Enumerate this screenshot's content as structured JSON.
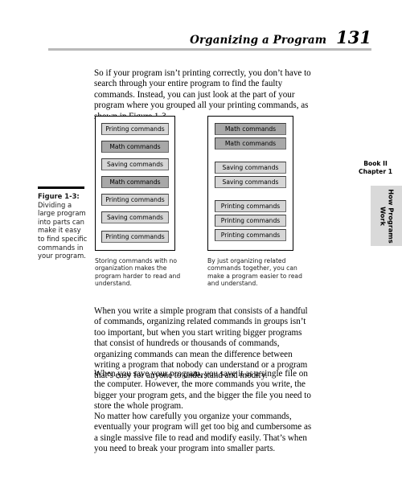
{
  "running_head": {
    "title": "Organizing a Program",
    "page_number": "131"
  },
  "body": {
    "paragraph_intro": "So if your program isn’t printing correctly, you don’t have to search through your entire program to find the faulty commands. Instead, you can just look at the part of your program where you grouped all your printing commands, as shown in Figure 1-3.",
    "paragraph_2": "When you write a simple program that consists of a handful of commands, organizing related commands in groups isn’t too important, but when you start writing bigger programs that consist of hundreds or thousands of commands, organizing commands can mean the difference between writing a program that nobody can understand or a program that’s easy for anyone to understand and modify.",
    "paragraph_3": "When you save your program, you save it as a single file on the computer. However, the more commands you write, the bigger your program gets, and the bigger the file you need to store the whole program.",
    "paragraph_4": "No matter how carefully you organize your commands, eventually your program will get too big and cumbersome as a single massive file to read and modify easily. That’s when you need to break your program into smaller parts."
  },
  "figure": {
    "caption_label": "Figure 1-3:",
    "caption_text": "Dividing a large program into parts can make it easy to find specific commands in your program.",
    "left_panel": {
      "subcaption": "Storing commands with no organization makes the program harder to read and understand.",
      "boxes": [
        {
          "label": "Printing commands",
          "shade": "light"
        },
        {
          "label": "Math commands",
          "shade": "dark"
        },
        {
          "label": "Saving commands",
          "shade": "light"
        },
        {
          "label": "Math commands",
          "shade": "dark"
        },
        {
          "label": "Printing commands",
          "shade": "light"
        },
        {
          "label": "Saving commands",
          "shade": "light"
        },
        {
          "label": "Printing commands",
          "shade": "light"
        }
      ]
    },
    "right_panel": {
      "subcaption": "By just organizing related commands together, you can make a program easier to read and understand.",
      "boxes": [
        {
          "label": "Math commands",
          "shade": "dark"
        },
        {
          "label": "Math commands",
          "shade": "dark"
        },
        {
          "label": "Saving commands",
          "shade": "light"
        },
        {
          "label": "Saving commands",
          "shade": "light"
        },
        {
          "label": "Printing commands",
          "shade": "light"
        },
        {
          "label": "Printing commands",
          "shade": "light"
        },
        {
          "label": "Printing commands",
          "shade": "light"
        }
      ]
    }
  },
  "margin_tab": {
    "book_line": "Book II",
    "chapter_line": "Chapter 1",
    "chapter_title": "How Programs\nWork"
  },
  "colors": {
    "rule_gray": "#b9b9b9",
    "tab_gray": "#d9d9d9",
    "box_light": "#d6d6d6",
    "box_dark": "#a8a8a8"
  }
}
